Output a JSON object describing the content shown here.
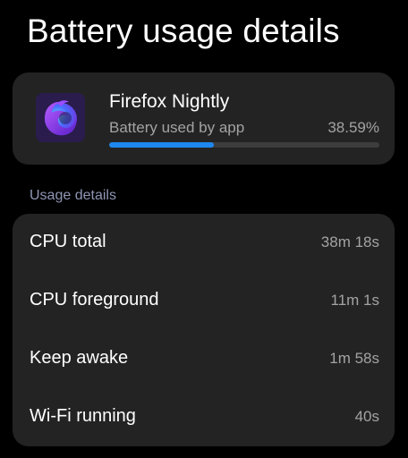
{
  "header": {
    "title": "Battery usage details"
  },
  "app": {
    "icon": "firefox-nightly-icon",
    "name": "Firefox Nightly",
    "subtitle": "Battery used by app",
    "percent_text": "38.59%",
    "usage_fraction": 0.3859,
    "bar_color": "#1e88f0"
  },
  "usage": {
    "section_title": "Usage details",
    "rows": [
      {
        "label": "CPU total",
        "value": "38m 18s"
      },
      {
        "label": "CPU foreground",
        "value": "11m 1s"
      },
      {
        "label": "Keep awake",
        "value": "1m 58s"
      },
      {
        "label": "Wi-Fi running",
        "value": "40s"
      }
    ]
  }
}
